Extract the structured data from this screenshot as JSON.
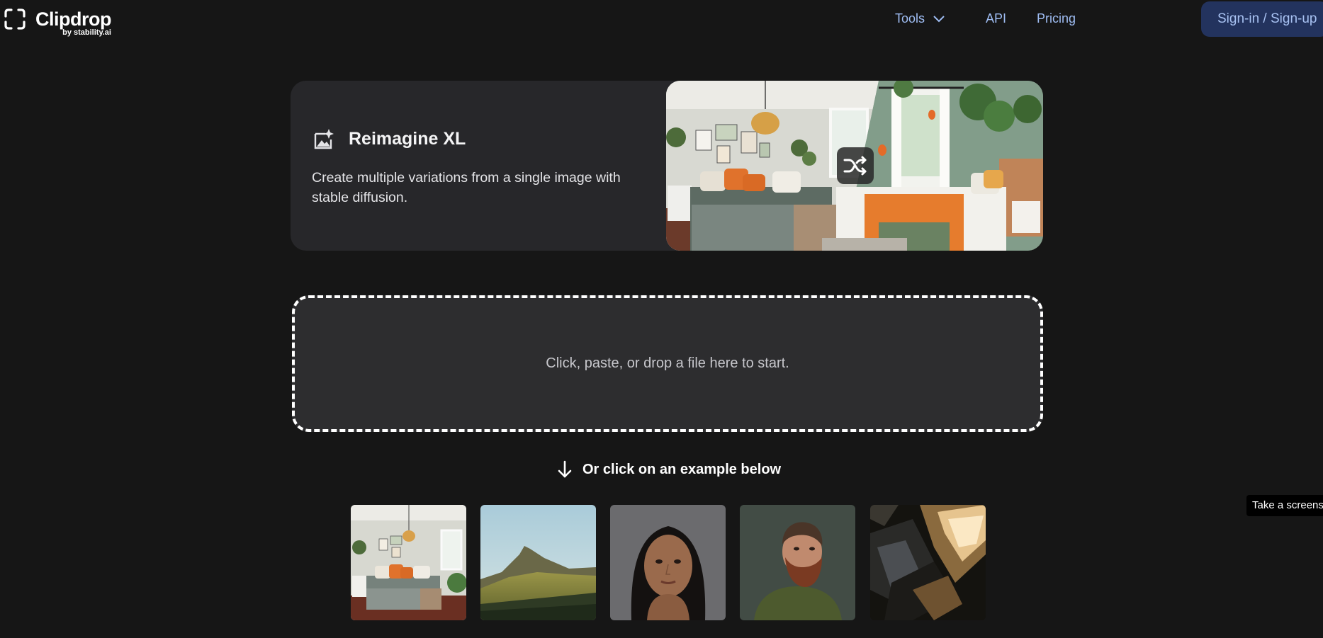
{
  "header": {
    "logo_name": "Clipdrop",
    "logo_by": "by stability.ai",
    "nav": [
      {
        "label": "Tools",
        "icon": "chevron-down-icon"
      },
      {
        "label": "API"
      },
      {
        "label": "Pricing"
      }
    ],
    "signin_label": "Sign-in / Sign-up"
  },
  "hero": {
    "icon": "image-sparkle-icon",
    "title": "Reimagine XL",
    "description": "Create multiple variations from a single image with stable diffusion.",
    "shuffle_icon": "shuffle-icon"
  },
  "dropzone": {
    "text": "Click, paste, or drop a file here to start."
  },
  "examples": {
    "heading": "Or click on an example below",
    "arrow_icon": "arrow-down-icon",
    "items": [
      {
        "name": "example-bedroom"
      },
      {
        "name": "example-landscape"
      },
      {
        "name": "example-portrait-woman"
      },
      {
        "name": "example-portrait-man"
      },
      {
        "name": "example-abstract"
      }
    ]
  },
  "tooltip": {
    "text": "Take a screens"
  },
  "colors": {
    "background": "#161616",
    "card": "#27272a",
    "nav_link": "#9fbdf3",
    "signin_bg": "#23335e"
  }
}
